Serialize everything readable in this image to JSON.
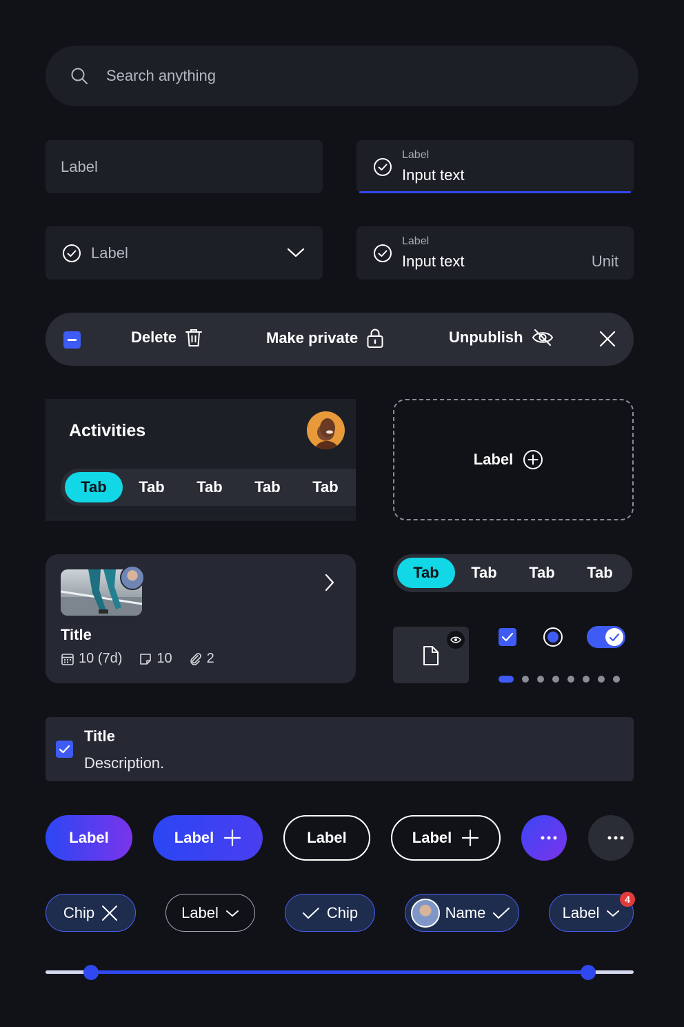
{
  "search": {
    "placeholder": "Search anything",
    "icon": "search-icon"
  },
  "fields": {
    "plain": {
      "label": "Label"
    },
    "active": {
      "label": "Label",
      "value": "Input text"
    },
    "select": {
      "label": "Label"
    },
    "unit": {
      "label": "Label",
      "value": "Input text",
      "unit": "Unit"
    }
  },
  "actionbar": {
    "delete": "Delete",
    "make_private": "Make private",
    "unpublish": "Unpublish"
  },
  "activities": {
    "title": "Activities",
    "tabs": [
      "Tab",
      "Tab",
      "Tab",
      "Tab",
      "Tab"
    ],
    "active_tab": 0
  },
  "dashed_add": {
    "label": "Label"
  },
  "card": {
    "title": "Title",
    "meta": {
      "date": "10 (7d)",
      "notes": "10",
      "attachments": "2"
    }
  },
  "tabs2": {
    "tabs": [
      "Tab",
      "Tab",
      "Tab",
      "Tab"
    ],
    "active_tab": 0
  },
  "controls": {
    "checkbox_checked": true,
    "radio_selected": true,
    "toggle_on": true,
    "pager_total": 8,
    "pager_active": 0
  },
  "checkrow": {
    "title": "Title",
    "description": "Description."
  },
  "buttons": {
    "primary": "Label",
    "primary_add": "Label",
    "outline": "Label",
    "outline_add": "Label"
  },
  "chips": {
    "chip_remove": "Chip",
    "dropdown": "Label",
    "chip_selected": "Chip",
    "person": "Name",
    "label_badge": "Label",
    "badge_count": "4"
  },
  "slider": {
    "min_value": 0.077,
    "max_value": 0.922
  },
  "colors": {
    "accent": "#3e5bf4",
    "tab_active": "#11d7e6",
    "background": "#111218",
    "surface": "#1d1f27",
    "badge": "#e23b3b"
  }
}
